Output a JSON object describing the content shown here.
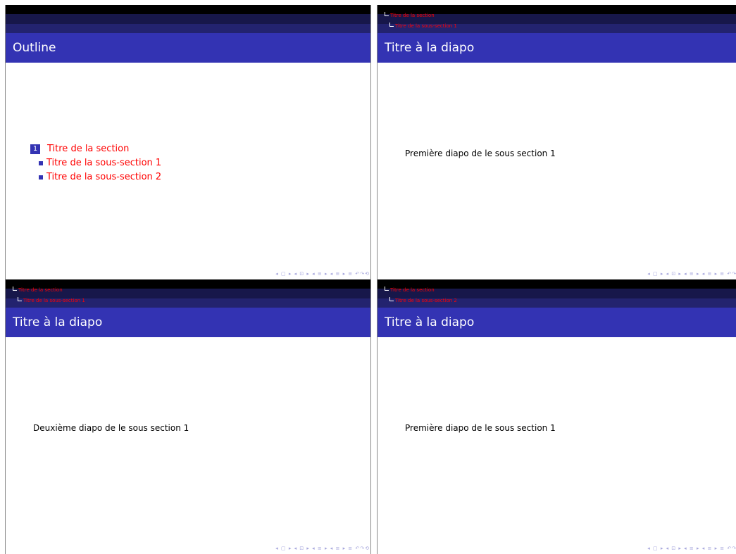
{
  "slides": [
    {
      "title": "Outline",
      "outline": {
        "section_number": "1",
        "section": "Titre de la section",
        "subsections": [
          "Titre de la sous-section 1",
          "Titre de la sous-section 2"
        ]
      }
    },
    {
      "title": "Titre à la diapo",
      "nav": {
        "section": "Titre de la section",
        "subsection": "Titre de la sous-section 1"
      },
      "body": "Première diapo de le sous section 1"
    },
    {
      "title": "Titre à la diapo",
      "nav": {
        "section": "Titre de la section",
        "subsection": "Titre de la sous-section 1"
      },
      "body": "Deuxième diapo de le sous section 1"
    },
    {
      "title": "Titre à la diapo",
      "nav": {
        "section": "Titre de la section",
        "subsection": "Titre de la sous-section 2"
      },
      "body": "Première diapo de le sous section 1"
    }
  ],
  "nav_symbols": "◂ ▢ ▸ ◂ ⊡ ▸ ◂ ≡ ▸ ◂ ≡ ▸   ≡   ↶↷⟲",
  "colors": {
    "accent": "#3333b3",
    "link": "#ff0000",
    "header_dark": "#000000"
  }
}
